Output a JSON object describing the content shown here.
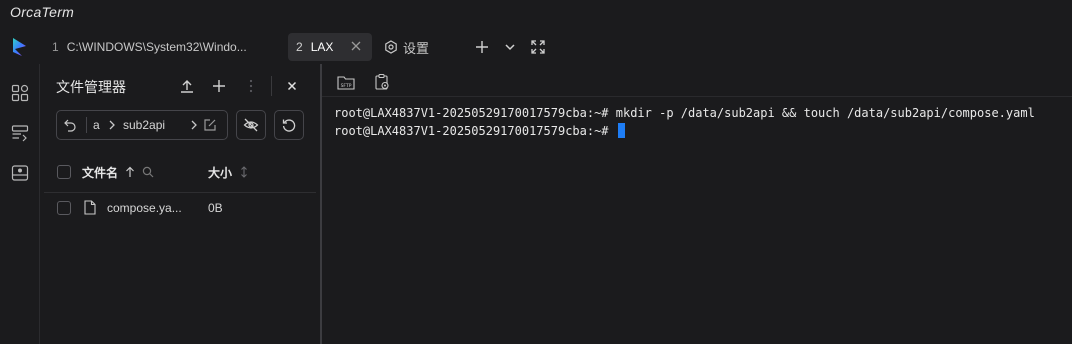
{
  "app": {
    "title": "OrcaTerm"
  },
  "tabs": [
    {
      "number": "1",
      "label": "C:\\WINDOWS\\System32\\Windo..."
    },
    {
      "number": "2",
      "label": "LAX"
    }
  ],
  "settings_tab": {
    "label": "设置"
  },
  "file_manager": {
    "title": "文件管理器",
    "path": {
      "segment_a": "a",
      "segment_b": "sub2api"
    },
    "columns": {
      "name": "文件名",
      "size": "大小"
    },
    "files": [
      {
        "name": "compose.ya...",
        "size": "0B"
      }
    ]
  },
  "terminal": {
    "toolbar": {
      "sftp_label": "SFTP"
    },
    "lines": [
      "root@LAX4837V1-20250529170017579cba:~# mkdir -p /data/sub2api && touch /data/sub2api/compose.yaml",
      "root@LAX4837V1-20250529170017579cba:~# "
    ],
    "cursor_color": "#1e7df5"
  },
  "colors": {
    "background": "#1b1b1d",
    "active_tab": "#2e2e31",
    "accent": "#1e7df5"
  }
}
